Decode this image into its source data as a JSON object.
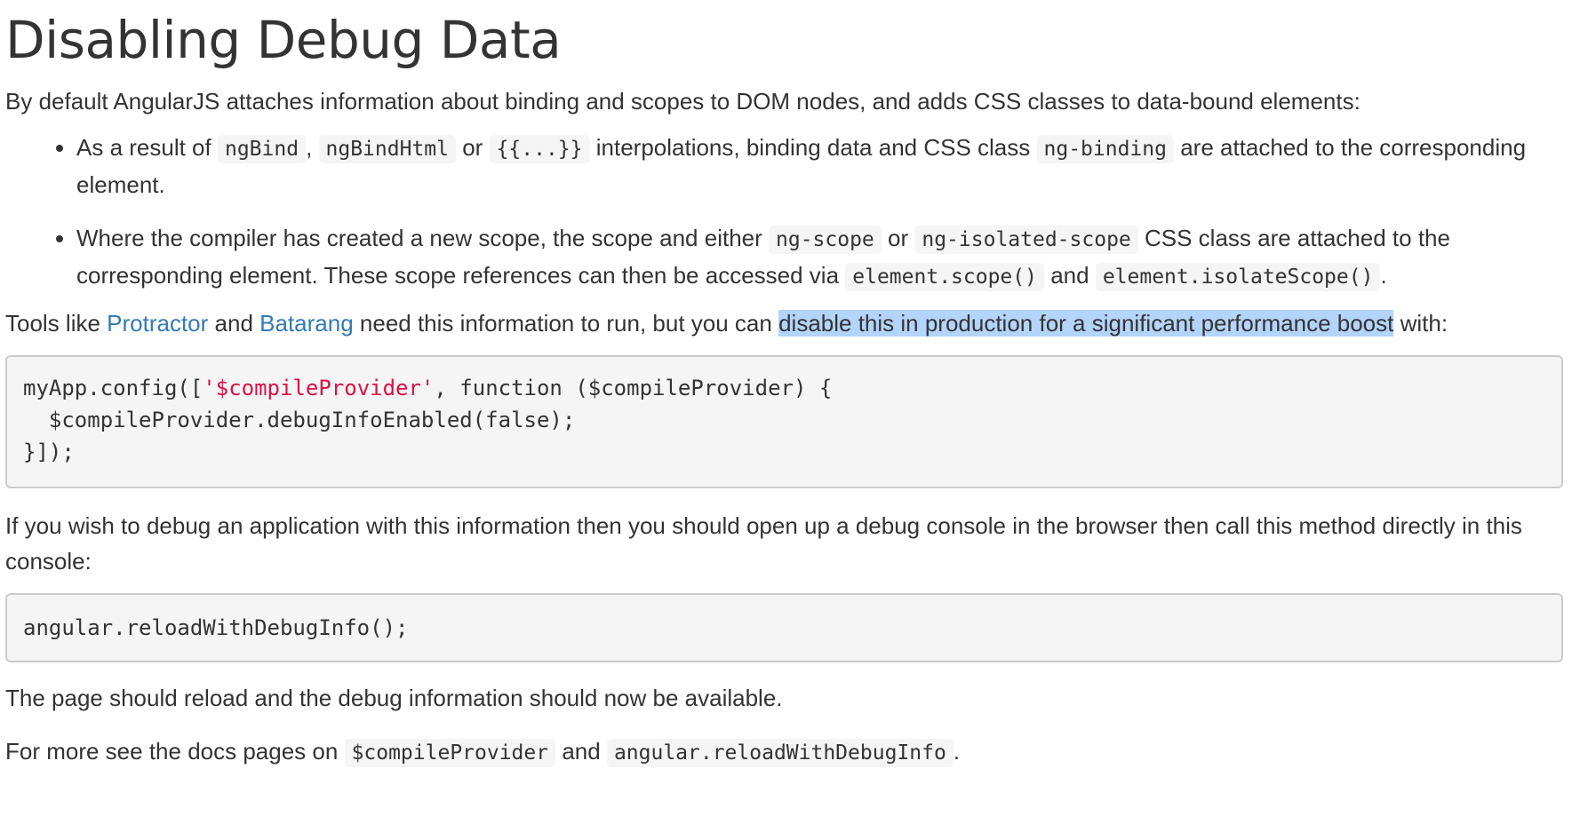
{
  "heading": "Disabling Debug Data",
  "intro": "By default AngularJS attaches information about binding and scopes to DOM nodes, and adds CSS classes to data-bound elements:",
  "bullet1": {
    "t1": "As a result of ",
    "c1": "ngBind",
    "t2": ", ",
    "c2": "ngBindHtml",
    "t3": " or ",
    "c3": "{{...}}",
    "t4": " interpolations, binding data and CSS class ",
    "c4": "ng-binding",
    "t5": " are attached to the corresponding element."
  },
  "bullet2": {
    "t1": "Where the compiler has created a new scope, the scope and either ",
    "c1": "ng-scope",
    "t2": " or ",
    "c2": "ng-isolated-scope",
    "t3": " CSS class are attached to the corresponding element. These scope references can then be accessed via ",
    "c3": "element.scope()",
    "t4": " and ",
    "c4": "element.isolateScope()",
    "t5": "."
  },
  "tools": {
    "t1": "Tools like ",
    "link1": "Protractor",
    "t2": " and ",
    "link2": "Batarang",
    "t3": " need this information to run, but you can ",
    "highlight": "disable this in production for a significant performance boost",
    "t4": " with:"
  },
  "code1": {
    "l1_a": "myApp.config([",
    "l1_str": "'$compileProvider'",
    "l1_b": ", function ($compileProvider) {",
    "l2": "  $compileProvider.debugInfoEnabled(false);",
    "l3": "}]);"
  },
  "debug_para": "If you wish to debug an application with this information then you should open up a debug console in the browser then call this method directly in this console:",
  "code2": "angular.reloadWithDebugInfo();",
  "reload_para": "The page should reload and the debug information should now be available.",
  "more": {
    "t1": "For more see the docs pages on ",
    "c1": "$compileProvider",
    "t2": " and ",
    "c2": "angular.reloadWithDebugInfo",
    "t3": "."
  },
  "colors": {
    "text": "#333333",
    "link": "#337ab7",
    "highlight": "#b3d4fc",
    "code_bg": "#f5f5f5",
    "code_string": "#dd1144"
  }
}
